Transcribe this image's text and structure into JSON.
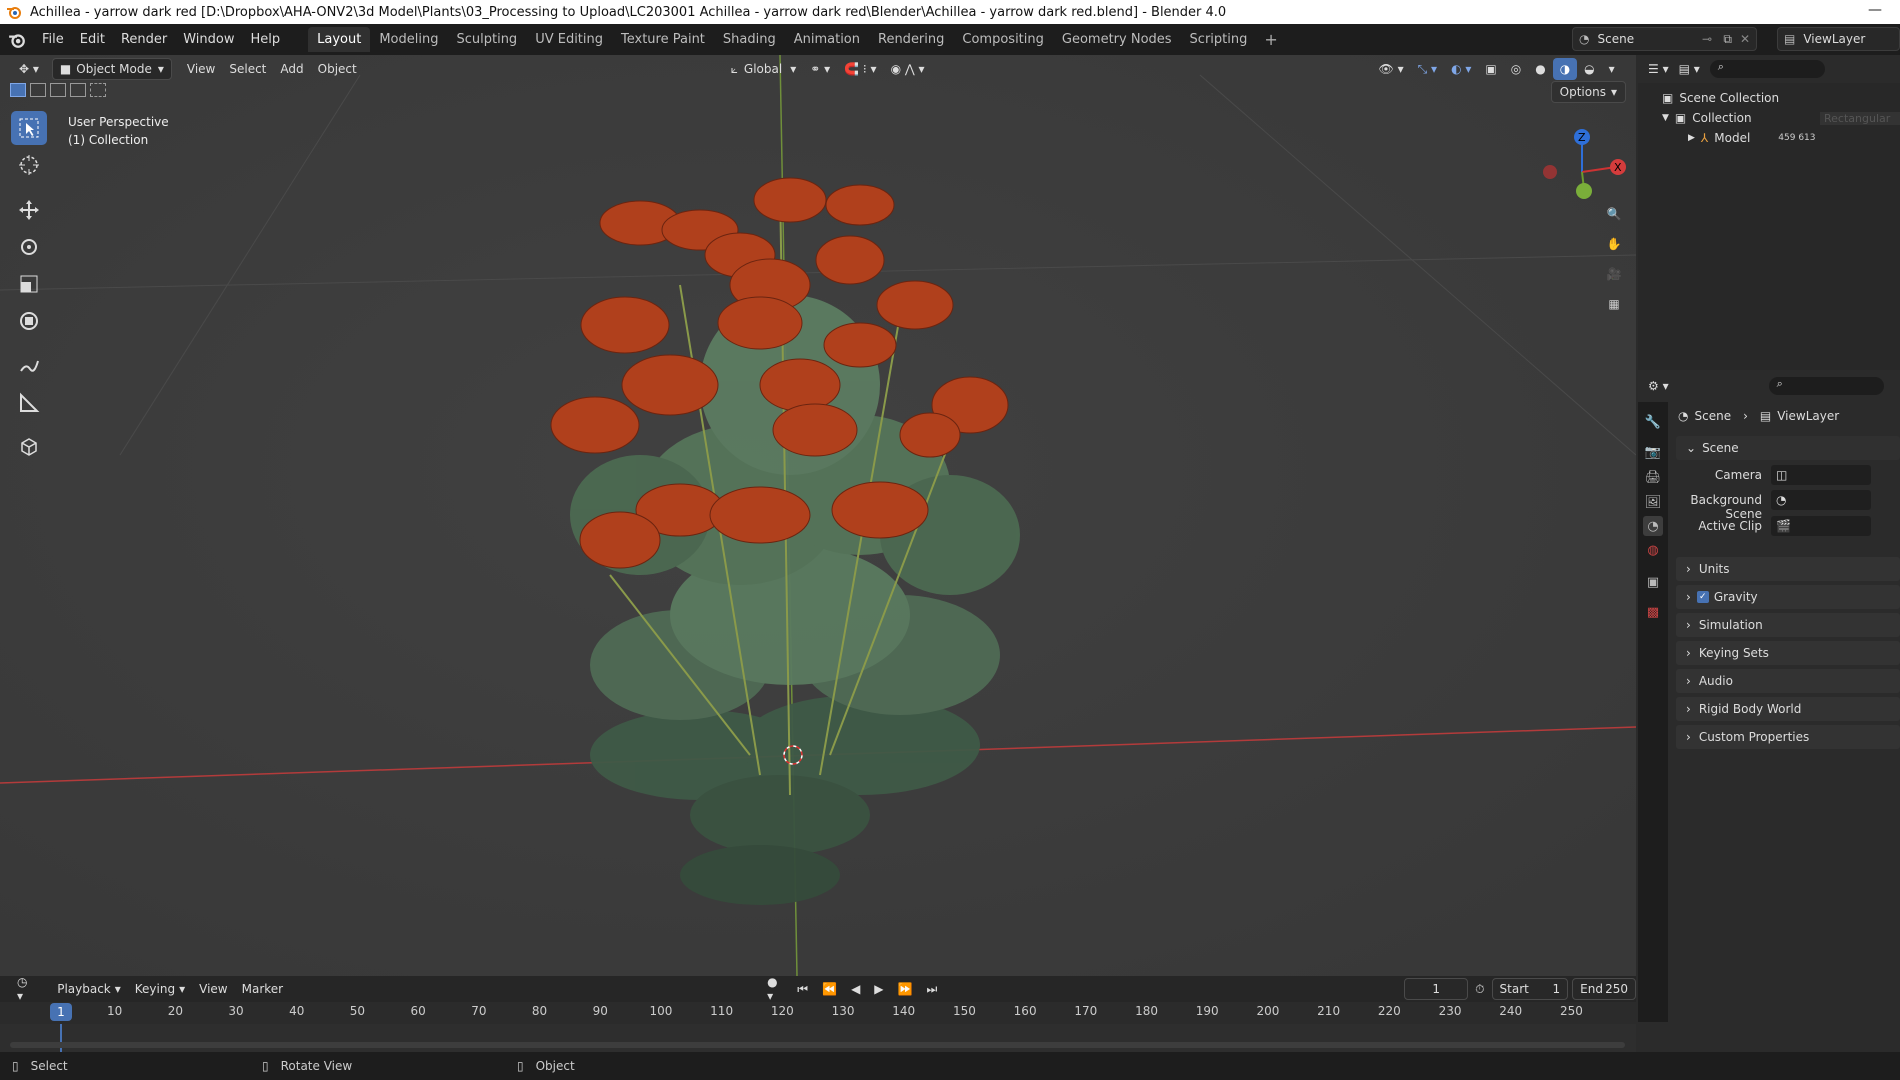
{
  "window": {
    "title": "Achillea - yarrow dark red [D:\\Dropbox\\AHA-ONV2\\3d Model\\Plants\\03_Processing to Upload\\LC203001 Achillea - yarrow dark red\\Blender\\Achillea - yarrow dark red.blend] - Blender 4.0"
  },
  "menu": {
    "file": "File",
    "edit": "Edit",
    "render": "Render",
    "window": "Window",
    "help": "Help"
  },
  "workspaces": [
    "Layout",
    "Modeling",
    "Sculpting",
    "UV Editing",
    "Texture Paint",
    "Shading",
    "Animation",
    "Rendering",
    "Compositing",
    "Geometry Nodes",
    "Scripting"
  ],
  "topright": {
    "scene": "Scene",
    "viewlayer": "ViewLayer"
  },
  "viewport": {
    "mode": "Object Mode",
    "menus": [
      "View",
      "Select",
      "Add",
      "Object"
    ],
    "orientation": "Global",
    "options": "Options",
    "info_line1": "User Perspective",
    "info_line2": "(1) Collection",
    "gizmo": {
      "z": "Z",
      "x": "X"
    }
  },
  "outliner": {
    "scene_collection": "Scene Collection",
    "collection": "Collection",
    "model": "Model",
    "model_counts": "459 613",
    "overlay_tag": "Rectangular"
  },
  "properties": {
    "breadcrumb_scene": "Scene",
    "breadcrumb_viewlayer": "ViewLayer",
    "section_scene": "Scene",
    "camera_label": "Camera",
    "background_scene_label": "Background Scene",
    "active_clip_label": "Active Clip",
    "panels": [
      "Units",
      "Gravity",
      "Simulation",
      "Keying Sets",
      "Audio",
      "Rigid Body World",
      "Custom Properties"
    ],
    "gravity_checked": true
  },
  "timeline": {
    "menus": [
      "Playback",
      "Keying",
      "View",
      "Marker"
    ],
    "current_frame": "1",
    "start_label": "Start",
    "start_value": "1",
    "end_label": "End",
    "end_value": "250",
    "ticks": [
      "10",
      "20",
      "30",
      "40",
      "50",
      "60",
      "70",
      "80",
      "90",
      "100",
      "110",
      "120",
      "130",
      "140",
      "150",
      "160",
      "170",
      "180",
      "190",
      "200",
      "210",
      "220",
      "230",
      "240",
      "250"
    ],
    "playhead_label": "1"
  },
  "status": {
    "select": "Select",
    "rotate": "Rotate View",
    "object": "Object"
  }
}
